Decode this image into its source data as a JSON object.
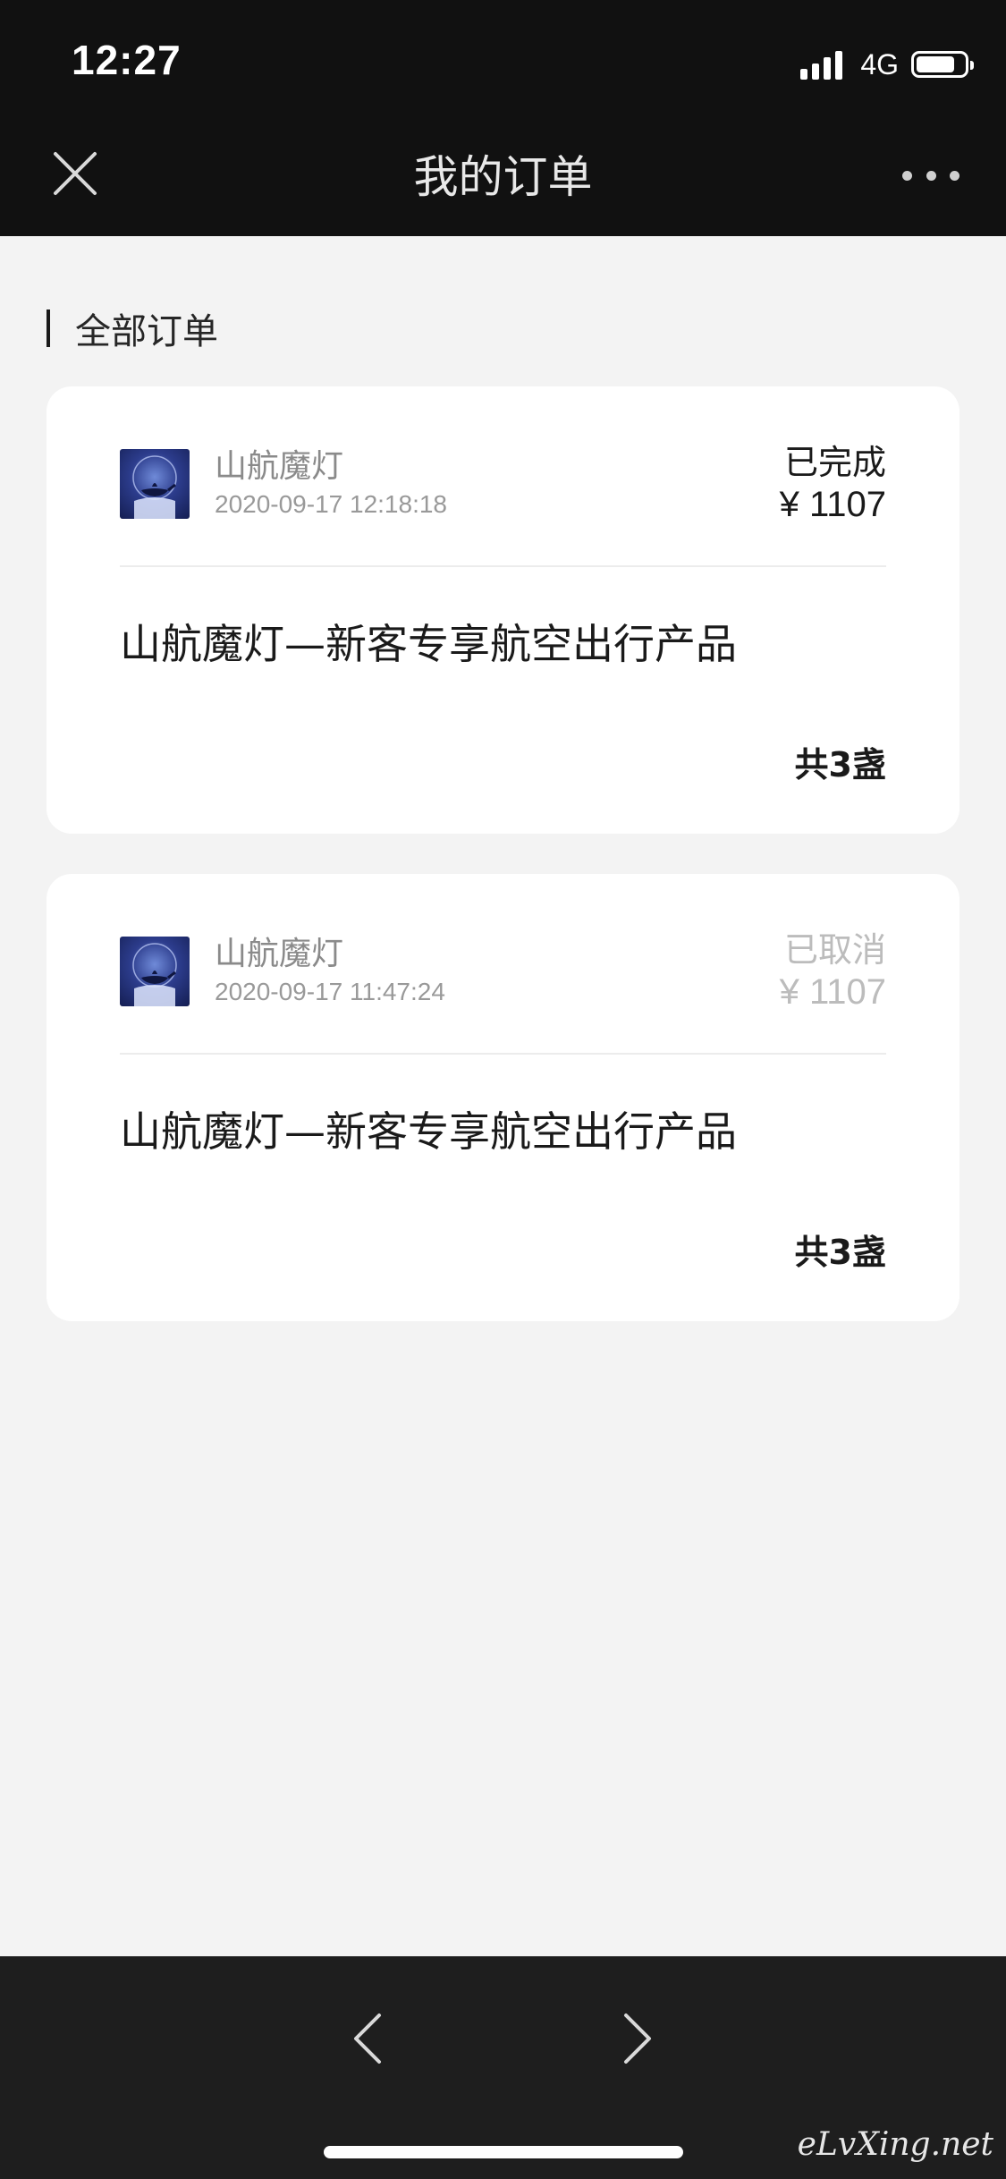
{
  "status_bar": {
    "time": "12:27",
    "network": "4G",
    "battery_level": 0.8
  },
  "nav": {
    "title": "我的订单",
    "close_icon": "close-icon",
    "more_icon": "more-dots-icon"
  },
  "section": {
    "label": "全部订单"
  },
  "orders": [
    {
      "merchant": "山航魔灯",
      "time": "2020-09-17 12:18:18",
      "status": "已完成",
      "price": "¥ 1107",
      "product": "山航魔灯—新客专享航空出行产品",
      "quantity": "共3盏"
    },
    {
      "merchant": "山航魔灯",
      "time": "2020-09-17 11:47:24",
      "status": "已取消",
      "price": "¥ 1107",
      "product": "山航魔灯—新客专享航空出行产品",
      "quantity": "共3盏"
    }
  ],
  "bottom_bar": {
    "back_icon": "chevron-left-icon",
    "forward_icon": "chevron-right-icon",
    "watermark": "eLvXing.net"
  },
  "colors": {
    "header_bg": "#111111",
    "page_bg": "#f3f3f3",
    "card_bg": "#ffffff",
    "cancelled_text": "#bcbcbc",
    "bottom_bar_bg": "#1e1e1e"
  }
}
